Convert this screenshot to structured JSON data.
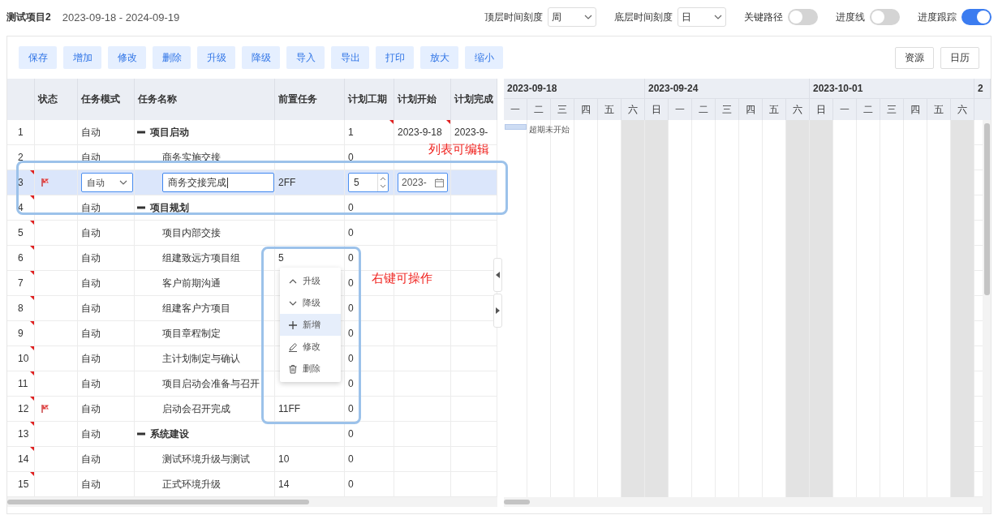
{
  "header": {
    "title": "测试项目2",
    "date_range": "2023-09-18 - 2024-09-19",
    "scales": [
      {
        "label": "顶层时间刻度",
        "value": "周"
      },
      {
        "label": "底层时间刻度",
        "value": "日"
      }
    ],
    "switches": [
      {
        "label": "关键路径",
        "on": false
      },
      {
        "label": "进度线",
        "on": false
      },
      {
        "label": "进度跟踪",
        "on": true
      }
    ]
  },
  "toolbar": {
    "buttons": [
      "保存",
      "增加",
      "修改",
      "删除",
      "升级",
      "降级",
      "导入",
      "导出",
      "打印",
      "放大",
      "缩小"
    ],
    "right_buttons": [
      "资源",
      "日历"
    ]
  },
  "table": {
    "columns": [
      "状态",
      "任务模式",
      "任务名称",
      "前置任务",
      "计划工期",
      "计划开始",
      "计划完成"
    ],
    "rows": [
      {
        "number": "1",
        "marked": false,
        "flag": false,
        "mode": "自动",
        "name": "项目启动",
        "duration": "1",
        "start": "2023-9-18",
        "finish": "2023-9-",
        "duration_marked": true,
        "start_marked": true,
        "editing": false,
        "expanded": true,
        "gantt_bar": {
          "label": "超期未开始"
        },
        "children": [
          {
            "number": "2",
            "marked": false,
            "flag": false,
            "mode": "自动",
            "name": "商务实施交接",
            "duration": "0",
            "duration_marked": false,
            "start_marked": false,
            "editing": false
          },
          {
            "number": "3",
            "marked": true,
            "flag": true,
            "mode": "自动",
            "name": "商务交接完成",
            "predecessor": "2FF",
            "duration": "5",
            "start": "2023-",
            "duration_marked": false,
            "start_marked": false,
            "editing": true
          }
        ]
      },
      {
        "number": "4",
        "marked": true,
        "flag": false,
        "mode": "自动",
        "name": "项目规划",
        "duration": "0",
        "duration_marked": false,
        "start_marked": false,
        "editing": false,
        "expanded": true,
        "children": [
          {
            "number": "5",
            "marked": true,
            "flag": false,
            "mode": "自动",
            "name": "项目内部交接",
            "duration": "0",
            "duration_marked": false,
            "start_marked": false,
            "editing": false
          },
          {
            "number": "6",
            "marked": true,
            "flag": false,
            "mode": "自动",
            "name": "组建致远方项目组",
            "predecessor": "5",
            "duration": "0",
            "duration_marked": false,
            "start_marked": false,
            "editing": false
          },
          {
            "number": "7",
            "marked": true,
            "flag": false,
            "mode": "自动",
            "name": "客户前期沟通",
            "duration": "0",
            "duration_marked": false,
            "start_marked": false,
            "editing": false
          },
          {
            "number": "8",
            "marked": true,
            "flag": false,
            "mode": "自动",
            "name": "组建客户方项目",
            "duration": "0",
            "duration_marked": false,
            "start_marked": false,
            "editing": false
          },
          {
            "number": "9",
            "marked": true,
            "flag": false,
            "mode": "自动",
            "name": "项目章程制定",
            "duration": "0",
            "duration_marked": false,
            "start_marked": false,
            "editing": false
          },
          {
            "number": "10",
            "marked": true,
            "flag": false,
            "mode": "自动",
            "name": "主计划制定与确认",
            "duration": "0",
            "duration_marked": false,
            "start_marked": false,
            "editing": false
          },
          {
            "number": "11",
            "marked": true,
            "flag": false,
            "mode": "自动",
            "name": "项目启动会准备与召开",
            "duration": "0",
            "duration_marked": false,
            "start_marked": false,
            "editing": false
          },
          {
            "number": "12",
            "marked": true,
            "flag": true,
            "mode": "自动",
            "name": "启动会召开完成",
            "predecessor": "11FF",
            "duration": "0",
            "duration_marked": false,
            "start_marked": false,
            "editing": false
          }
        ]
      },
      {
        "number": "13",
        "marked": true,
        "flag": false,
        "mode": "自动",
        "name": "系统建设",
        "duration": "0",
        "duration_marked": false,
        "start_marked": false,
        "editing": false,
        "expanded": true,
        "children": [
          {
            "number": "14",
            "marked": true,
            "flag": false,
            "mode": "自动",
            "name": "测试环境升级与测试",
            "predecessor": "10",
            "duration": "0",
            "duration_marked": false,
            "start_marked": false,
            "editing": false
          },
          {
            "number": "15",
            "marked": true,
            "flag": false,
            "mode": "自动",
            "name": "正式环境升级",
            "predecessor": "14",
            "duration": "0",
            "duration_marked": false,
            "start_marked": false,
            "editing": false
          }
        ]
      }
    ]
  },
  "gantt": {
    "weeks": [
      "2023-09-18",
      "2023-09-24",
      "2023-10-01",
      "2"
    ],
    "days": [
      {
        "label": "一",
        "weekend": false
      },
      {
        "label": "二",
        "weekend": false
      },
      {
        "label": "三",
        "weekend": false
      },
      {
        "label": "四",
        "weekend": false
      },
      {
        "label": "五",
        "weekend": false
      },
      {
        "label": "六",
        "weekend": true
      },
      {
        "label": "日",
        "weekend": true
      },
      {
        "label": "一",
        "weekend": false
      },
      {
        "label": "二",
        "weekend": false
      },
      {
        "label": "三",
        "weekend": false
      },
      {
        "label": "四",
        "weekend": false
      },
      {
        "label": "五",
        "weekend": false
      },
      {
        "label": "六",
        "weekend": true
      },
      {
        "label": "日",
        "weekend": true
      },
      {
        "label": "一",
        "weekend": false
      },
      {
        "label": "二",
        "weekend": false
      },
      {
        "label": "三",
        "weekend": false
      },
      {
        "label": "四",
        "weekend": false
      },
      {
        "label": "五",
        "weekend": false
      },
      {
        "label": "六",
        "weekend": true
      }
    ]
  },
  "context_menu": {
    "items": [
      {
        "kind": "up",
        "label": "升级",
        "selected": false
      },
      {
        "kind": "down",
        "label": "降级",
        "selected": false
      },
      {
        "kind": "add",
        "label": "新增",
        "selected": true
      },
      {
        "kind": "edit",
        "label": "修改",
        "selected": false
      },
      {
        "kind": "delete",
        "label": "删除",
        "selected": false
      }
    ]
  },
  "annotations": [
    "列表可编辑",
    "右键可操作"
  ]
}
